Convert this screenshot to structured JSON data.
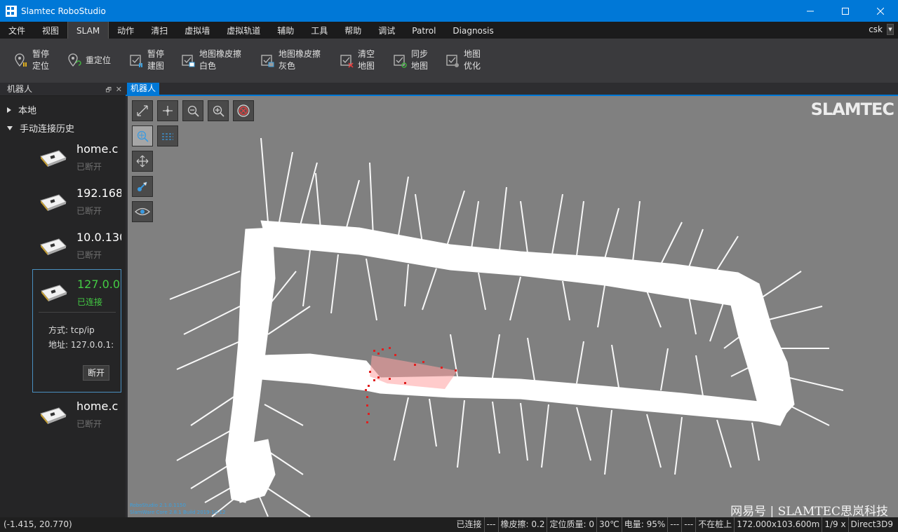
{
  "window": {
    "title": "Slamtec RoboStudio"
  },
  "menu": {
    "items": [
      "文件",
      "视图",
      "SLAM",
      "动作",
      "清扫",
      "虚拟墙",
      "虚拟轨道",
      "辅助",
      "工具",
      "帮助",
      "调试",
      "Patrol",
      "Diagnosis"
    ],
    "active": "SLAM",
    "user": "csk"
  },
  "ribbon": [
    {
      "line1": "暂停",
      "line2": "定位",
      "icon": "pin-pause-icon"
    },
    {
      "line1": "重定位",
      "line2": "",
      "icon": "pin-relocate-icon"
    },
    {
      "line1": "暂停",
      "line2": "建图",
      "icon": "map-pause-icon"
    },
    {
      "line1": "地图橡皮擦",
      "line2": "白色",
      "icon": "eraser-white-icon"
    },
    {
      "line1": "地图橡皮擦",
      "line2": "灰色",
      "icon": "eraser-gray-icon"
    },
    {
      "line1": "清空",
      "line2": "地图",
      "icon": "clear-map-icon"
    },
    {
      "line1": "同步",
      "line2": "地图",
      "icon": "sync-map-icon"
    },
    {
      "line1": "地图",
      "line2": "优化",
      "icon": "optimize-map-icon"
    }
  ],
  "panel": {
    "title": "机器人",
    "tree": {
      "local": "本地",
      "history": "手动连接历史"
    },
    "robots": [
      {
        "name": "home.c",
        "status": "已断开"
      },
      {
        "name": "192.168",
        "status": "已断开"
      },
      {
        "name": "10.0.130",
        "status": "已断开"
      },
      {
        "name": "127.0.0.",
        "status": "已连接",
        "mode": "方式: tcp/ip",
        "address": "地址: 127.0.0.1:",
        "button": "断开"
      },
      {
        "name": "home.c",
        "status": "已断开"
      }
    ]
  },
  "doc_tab": "机器人",
  "map": {
    "brand": "SLAMTEC",
    "info_line1": "RoboStudio 2.1.0.1150",
    "info_line2": "SlamWare Core 2.8.1 Build 2019-10-12",
    "watermark": "网易号 | SLAMTEC思岚科技"
  },
  "status": {
    "coord": "(-1.415, 20.770)",
    "segments": [
      "已连接",
      "---",
      "橡皮擦: 0.2",
      "定位质量: 0",
      "30℃",
      "电量: 95%",
      "---",
      "---",
      "不在桩上",
      "172.000x103.600m",
      "1/9 x",
      "Direct3D9"
    ]
  }
}
